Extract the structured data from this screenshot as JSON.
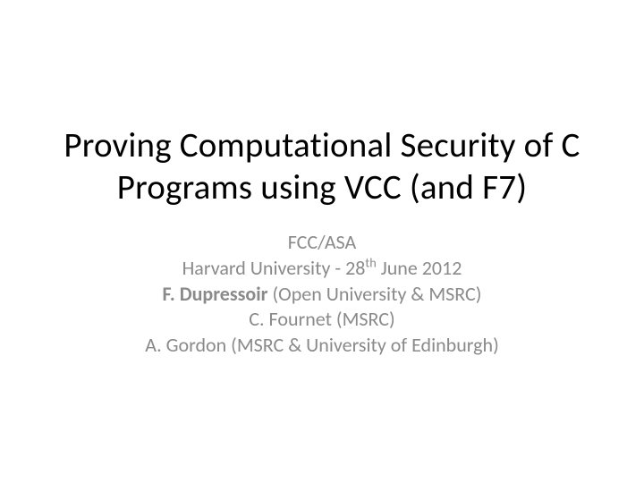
{
  "title": "Proving Computational Security of C Programs using VCC (and F7)",
  "event": "FCC/ASA",
  "venue_prefix": "Harvard University - 28",
  "venue_suffix": " June 2012",
  "venue_ordinal": "th",
  "author1_name": "F. Dupressoir",
  "author1_affil": " (Open University & MSRC)",
  "author2": "C. Fournet (MSRC)",
  "author3": "A. Gordon (MSRC & University of Edinburgh)"
}
